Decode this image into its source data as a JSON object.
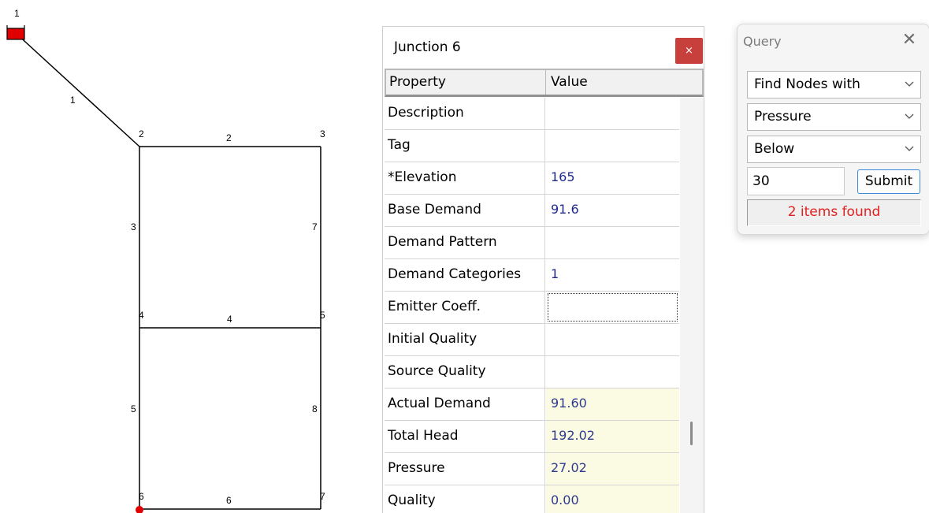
{
  "network": {
    "nodes": [
      {
        "id": "1",
        "type": "reservoir"
      },
      {
        "id": "2"
      },
      {
        "id": "3"
      },
      {
        "id": "4"
      },
      {
        "id": "5"
      },
      {
        "id": "6",
        "highlighted": true
      },
      {
        "id": "7"
      }
    ],
    "links": [
      "1",
      "2",
      "3",
      "4",
      "5",
      "6",
      "7",
      "8"
    ],
    "colors": {
      "pipe": "#000000",
      "reservoir": "#e00000",
      "highlight": "#e00000"
    }
  },
  "property_editor": {
    "title": "Junction 6",
    "close_label": "×",
    "header": {
      "property": "Property",
      "value": "Value"
    },
    "rows": [
      {
        "name": "Description",
        "value": ""
      },
      {
        "name": "Tag",
        "value": ""
      },
      {
        "name": "*Elevation",
        "value": "165"
      },
      {
        "name": "Base Demand",
        "value": "91.6"
      },
      {
        "name": "Demand Pattern",
        "value": ""
      },
      {
        "name": "Demand Categories",
        "value": "1"
      },
      {
        "name": "Emitter Coeff.",
        "value": "",
        "focused": true
      },
      {
        "name": "Initial Quality",
        "value": ""
      },
      {
        "name": "Source Quality",
        "value": ""
      },
      {
        "name": "Actual Demand",
        "value": "91.60",
        "readonly": true
      },
      {
        "name": "Total Head",
        "value": "192.02",
        "readonly": true
      },
      {
        "name": "Pressure",
        "value": "27.02",
        "readonly": true
      },
      {
        "name": "Quality",
        "value": "0.00",
        "readonly": true
      }
    ]
  },
  "query": {
    "title": "Query",
    "close_label": "✕",
    "find_selected": "Find Nodes with",
    "parameter_selected": "Pressure",
    "relation_selected": "Below",
    "value": "30",
    "submit_label": "Submit",
    "status": "2 items found",
    "status_color": "#e02020"
  }
}
